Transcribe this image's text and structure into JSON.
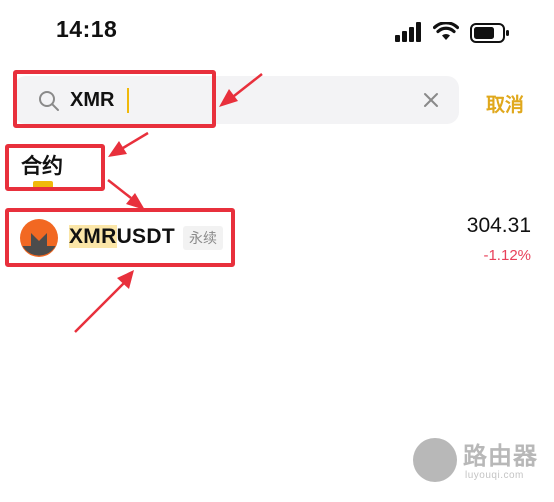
{
  "status_bar": {
    "time": "14:18",
    "icons": [
      "signal-icon",
      "wifi-icon",
      "battery-icon"
    ]
  },
  "search": {
    "query": "XMR",
    "cancel_label": "取消",
    "icons": [
      "search-icon",
      "clear-icon"
    ]
  },
  "section": {
    "title": "合约"
  },
  "results": [
    {
      "symbol_match": "XMR",
      "symbol_rest": "USDT",
      "tag": "永续",
      "price": "304.31",
      "change": "-1.12%",
      "change_color": "#e8405a",
      "icon": "monero-logo-icon"
    }
  ],
  "colors": {
    "accent": "#f0b90b",
    "cancel": "#e0a81c",
    "annotation": "#e8303c",
    "negative": "#e8405a"
  },
  "watermark": {
    "text": "路由器",
    "url": "luyouqi.com"
  }
}
